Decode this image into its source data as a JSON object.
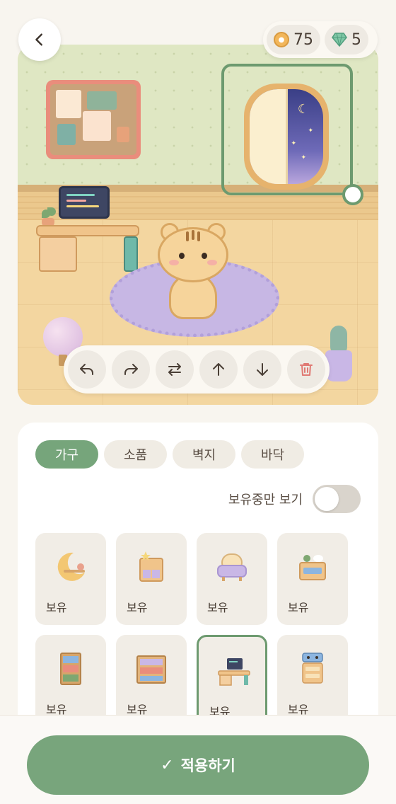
{
  "header": {
    "coins": "75",
    "gems": "5"
  },
  "scene": {
    "selected_item": "window"
  },
  "toolbar": {
    "tools": [
      "undo",
      "redo",
      "swap",
      "move-up",
      "move-down",
      "delete"
    ]
  },
  "tabs": [
    {
      "label": "가구",
      "active": true
    },
    {
      "label": "소품",
      "active": false
    },
    {
      "label": "벽지",
      "active": false
    },
    {
      "label": "바닥",
      "active": false
    }
  ],
  "filter": {
    "owned_only_label": "보유중만 보기",
    "owned_only_on": false
  },
  "items": [
    {
      "name": "moon-shelf",
      "label": "보유",
      "selected": false
    },
    {
      "name": "cabinet",
      "label": "보유",
      "selected": false
    },
    {
      "name": "armchair",
      "label": "보유",
      "selected": false
    },
    {
      "name": "nightstand",
      "label": "보유",
      "selected": false
    },
    {
      "name": "bookshelf-tall",
      "label": "보유",
      "selected": false
    },
    {
      "name": "bookshelf-wide",
      "label": "보유",
      "selected": false
    },
    {
      "name": "computer-desk",
      "label": "보유",
      "selected": true
    },
    {
      "name": "robot-drawer",
      "label": "보유",
      "selected": false
    }
  ],
  "footer": {
    "apply_label": "적용하기"
  },
  "colors": {
    "accent": "#76a57b",
    "background": "#f8f5ef"
  }
}
